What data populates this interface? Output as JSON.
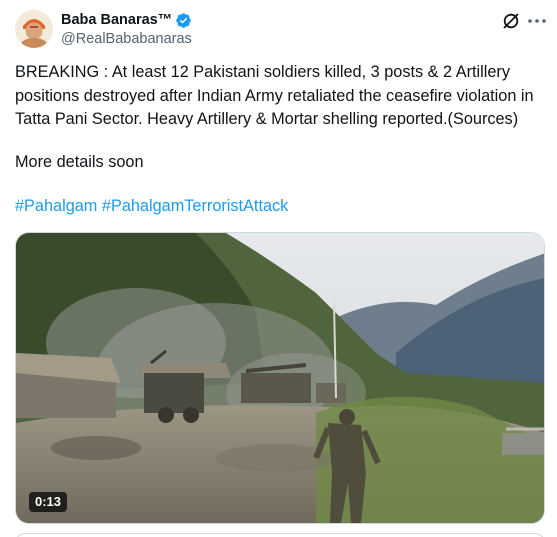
{
  "author": {
    "display_name": "Baba Banaras™",
    "handle": "@RealBababanaras",
    "verified": true,
    "verified_color": "#1d9bf0"
  },
  "icons": {
    "grok": "grok-icon",
    "more": "more-icon"
  },
  "tweet": {
    "text": "BREAKING : At least 12 Pakistani soldiers killed, 3 posts & 2 Artillery positions destroyed after Indian Army retaliated the ceasefire violation in Tatta Pani Sector. Heavy Artillery & Mortar shelling reported.(Sources)",
    "more_details": "More details soon",
    "hashtags": [
      "#Pahalgam",
      "#PahalgamTerroristAttack"
    ]
  },
  "media": {
    "type": "video",
    "duration": "0:13"
  },
  "colors": {
    "text": "#0f1419",
    "secondary": "#536471",
    "link": "#1d9bf0",
    "border": "#cfd9de"
  }
}
